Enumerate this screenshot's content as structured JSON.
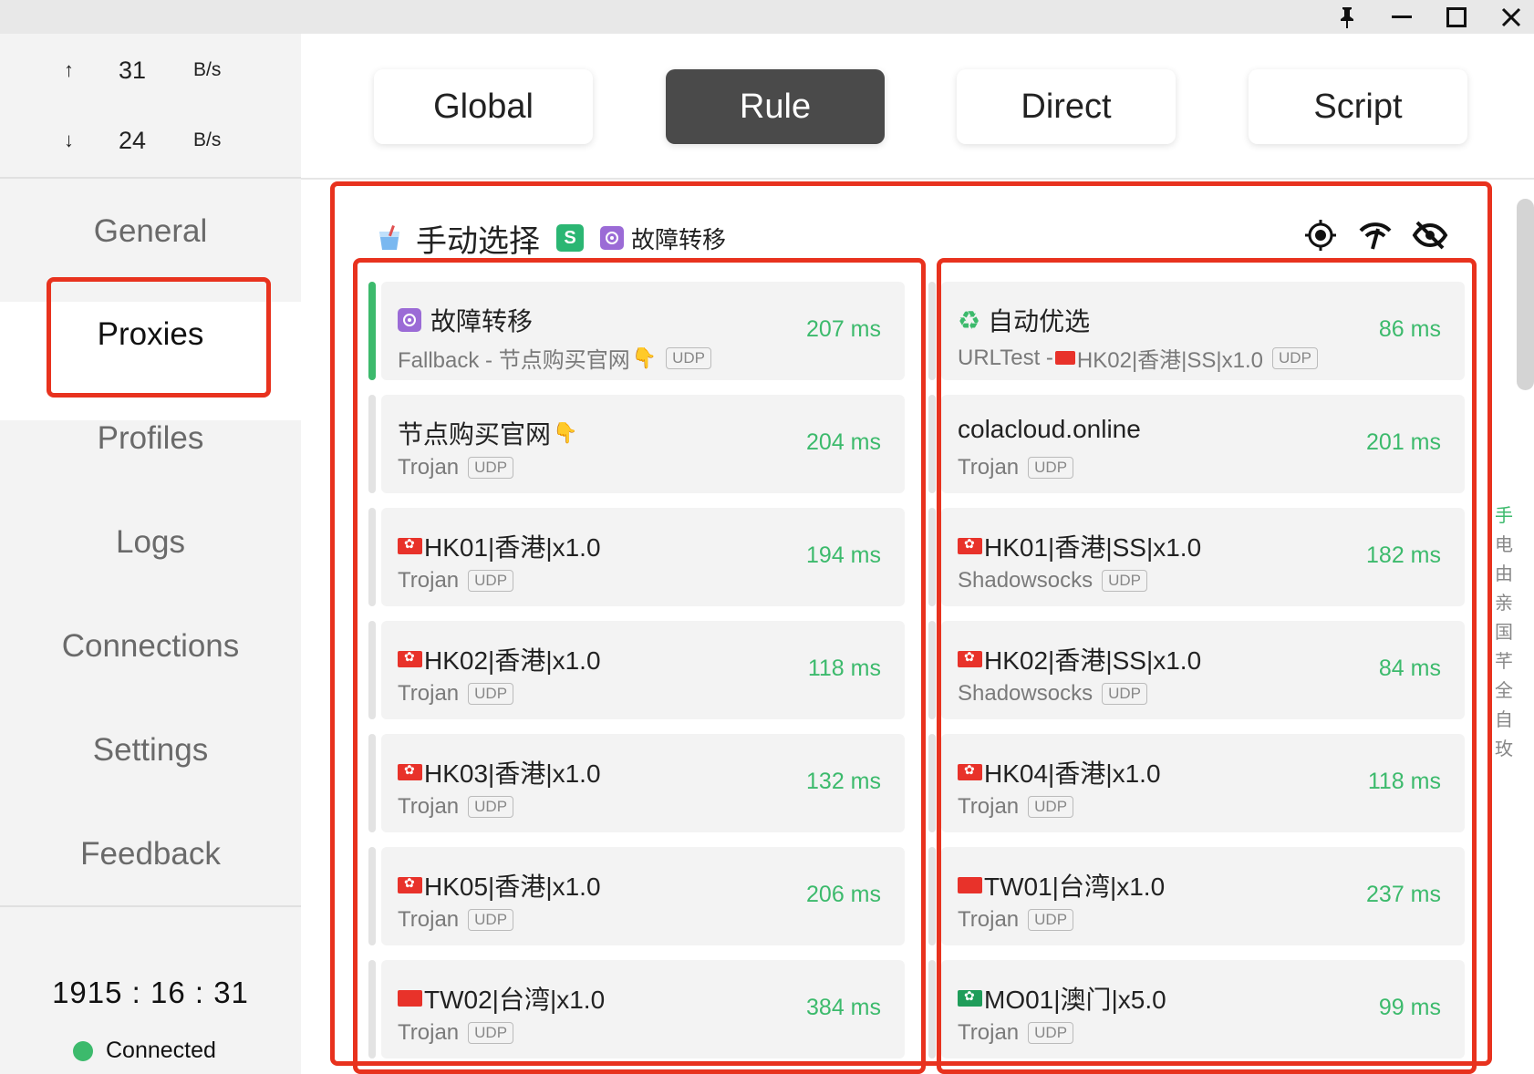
{
  "titlebar": {
    "icons": [
      "pin-icon",
      "minimize-icon",
      "maximize-icon",
      "close-icon"
    ]
  },
  "traffic": {
    "up": {
      "arrow": "↑",
      "value": "31",
      "unit": "B/s"
    },
    "down": {
      "arrow": "↓",
      "value": "24",
      "unit": "B/s"
    }
  },
  "nav": {
    "general": "General",
    "proxies": "Proxies",
    "profiles": "Profiles",
    "logs": "Logs",
    "connections": "Connections",
    "settings": "Settings",
    "feedback": "Feedback",
    "active": "Proxies"
  },
  "clock": "1915 : 16 : 31",
  "status": "Connected",
  "modes": {
    "global": "Global",
    "rule": "Rule",
    "direct": "Direct",
    "script": "Script",
    "active": "Rule"
  },
  "group": {
    "name": "手动选择",
    "badge": "S",
    "now": "故障转移",
    "icons": [
      "locate-icon",
      "latency-test-icon",
      "hide-icon"
    ]
  },
  "proxies_left": [
    {
      "name": "故障转移",
      "type": "Fallback - 节点购买官网",
      "udp": "UDP",
      "delay": "207 ms",
      "selected": true,
      "icon": "gear"
    },
    {
      "name": "节点购买官网",
      "type": "Trojan",
      "udp": "UDP",
      "delay": "204 ms"
    },
    {
      "name": "HK01|香港|x1.0",
      "type": "Trojan",
      "udp": "UDP",
      "delay": "194 ms",
      "flag": "hk"
    },
    {
      "name": "HK02|香港|x1.0",
      "type": "Trojan",
      "udp": "UDP",
      "delay": "118 ms",
      "flag": "hk"
    },
    {
      "name": "HK03|香港|x1.0",
      "type": "Trojan",
      "udp": "UDP",
      "delay": "132 ms",
      "flag": "hk"
    },
    {
      "name": "HK05|香港|x1.0",
      "type": "Trojan",
      "udp": "UDP",
      "delay": "206 ms",
      "flag": "hk"
    },
    {
      "name": "TW02|台湾|x1.0",
      "type": "Trojan",
      "udp": "UDP",
      "delay": "384 ms",
      "flag": "tw"
    }
  ],
  "proxies_right": [
    {
      "name": "自动优选",
      "type": "URLTest - ",
      "type_suffix": "HK02|香港|SS|x1.0",
      "udp": "UDP",
      "delay": "86 ms",
      "icon": "recycle"
    },
    {
      "name": "colacloud.online",
      "type": "Trojan",
      "udp": "UDP",
      "delay": "201 ms"
    },
    {
      "name": "HK01|香港|SS|x1.0",
      "type": "Shadowsocks",
      "udp": "UDP",
      "delay": "182 ms",
      "flag": "hk"
    },
    {
      "name": "HK02|香港|SS|x1.0",
      "type": "Shadowsocks",
      "udp": "UDP",
      "delay": "84 ms",
      "flag": "hk"
    },
    {
      "name": "HK04|香港|x1.0",
      "type": "Trojan",
      "udp": "UDP",
      "delay": "118 ms",
      "flag": "hk"
    },
    {
      "name": "TW01|台湾|x1.0",
      "type": "Trojan",
      "udp": "UDP",
      "delay": "237 ms",
      "flag": "tw"
    },
    {
      "name": "MO01|澳门|x5.0",
      "type": "Trojan",
      "udp": "UDP",
      "delay": "99 ms",
      "flag": "mo"
    }
  ],
  "side_index": [
    "手",
    "电",
    "由",
    "亲",
    "国",
    "芊",
    "全",
    "自",
    "玫"
  ],
  "colors": {
    "accent_green": "#3cba6c",
    "highlight_red": "#e8321e",
    "active_mode_bg": "#4a4a4a"
  }
}
